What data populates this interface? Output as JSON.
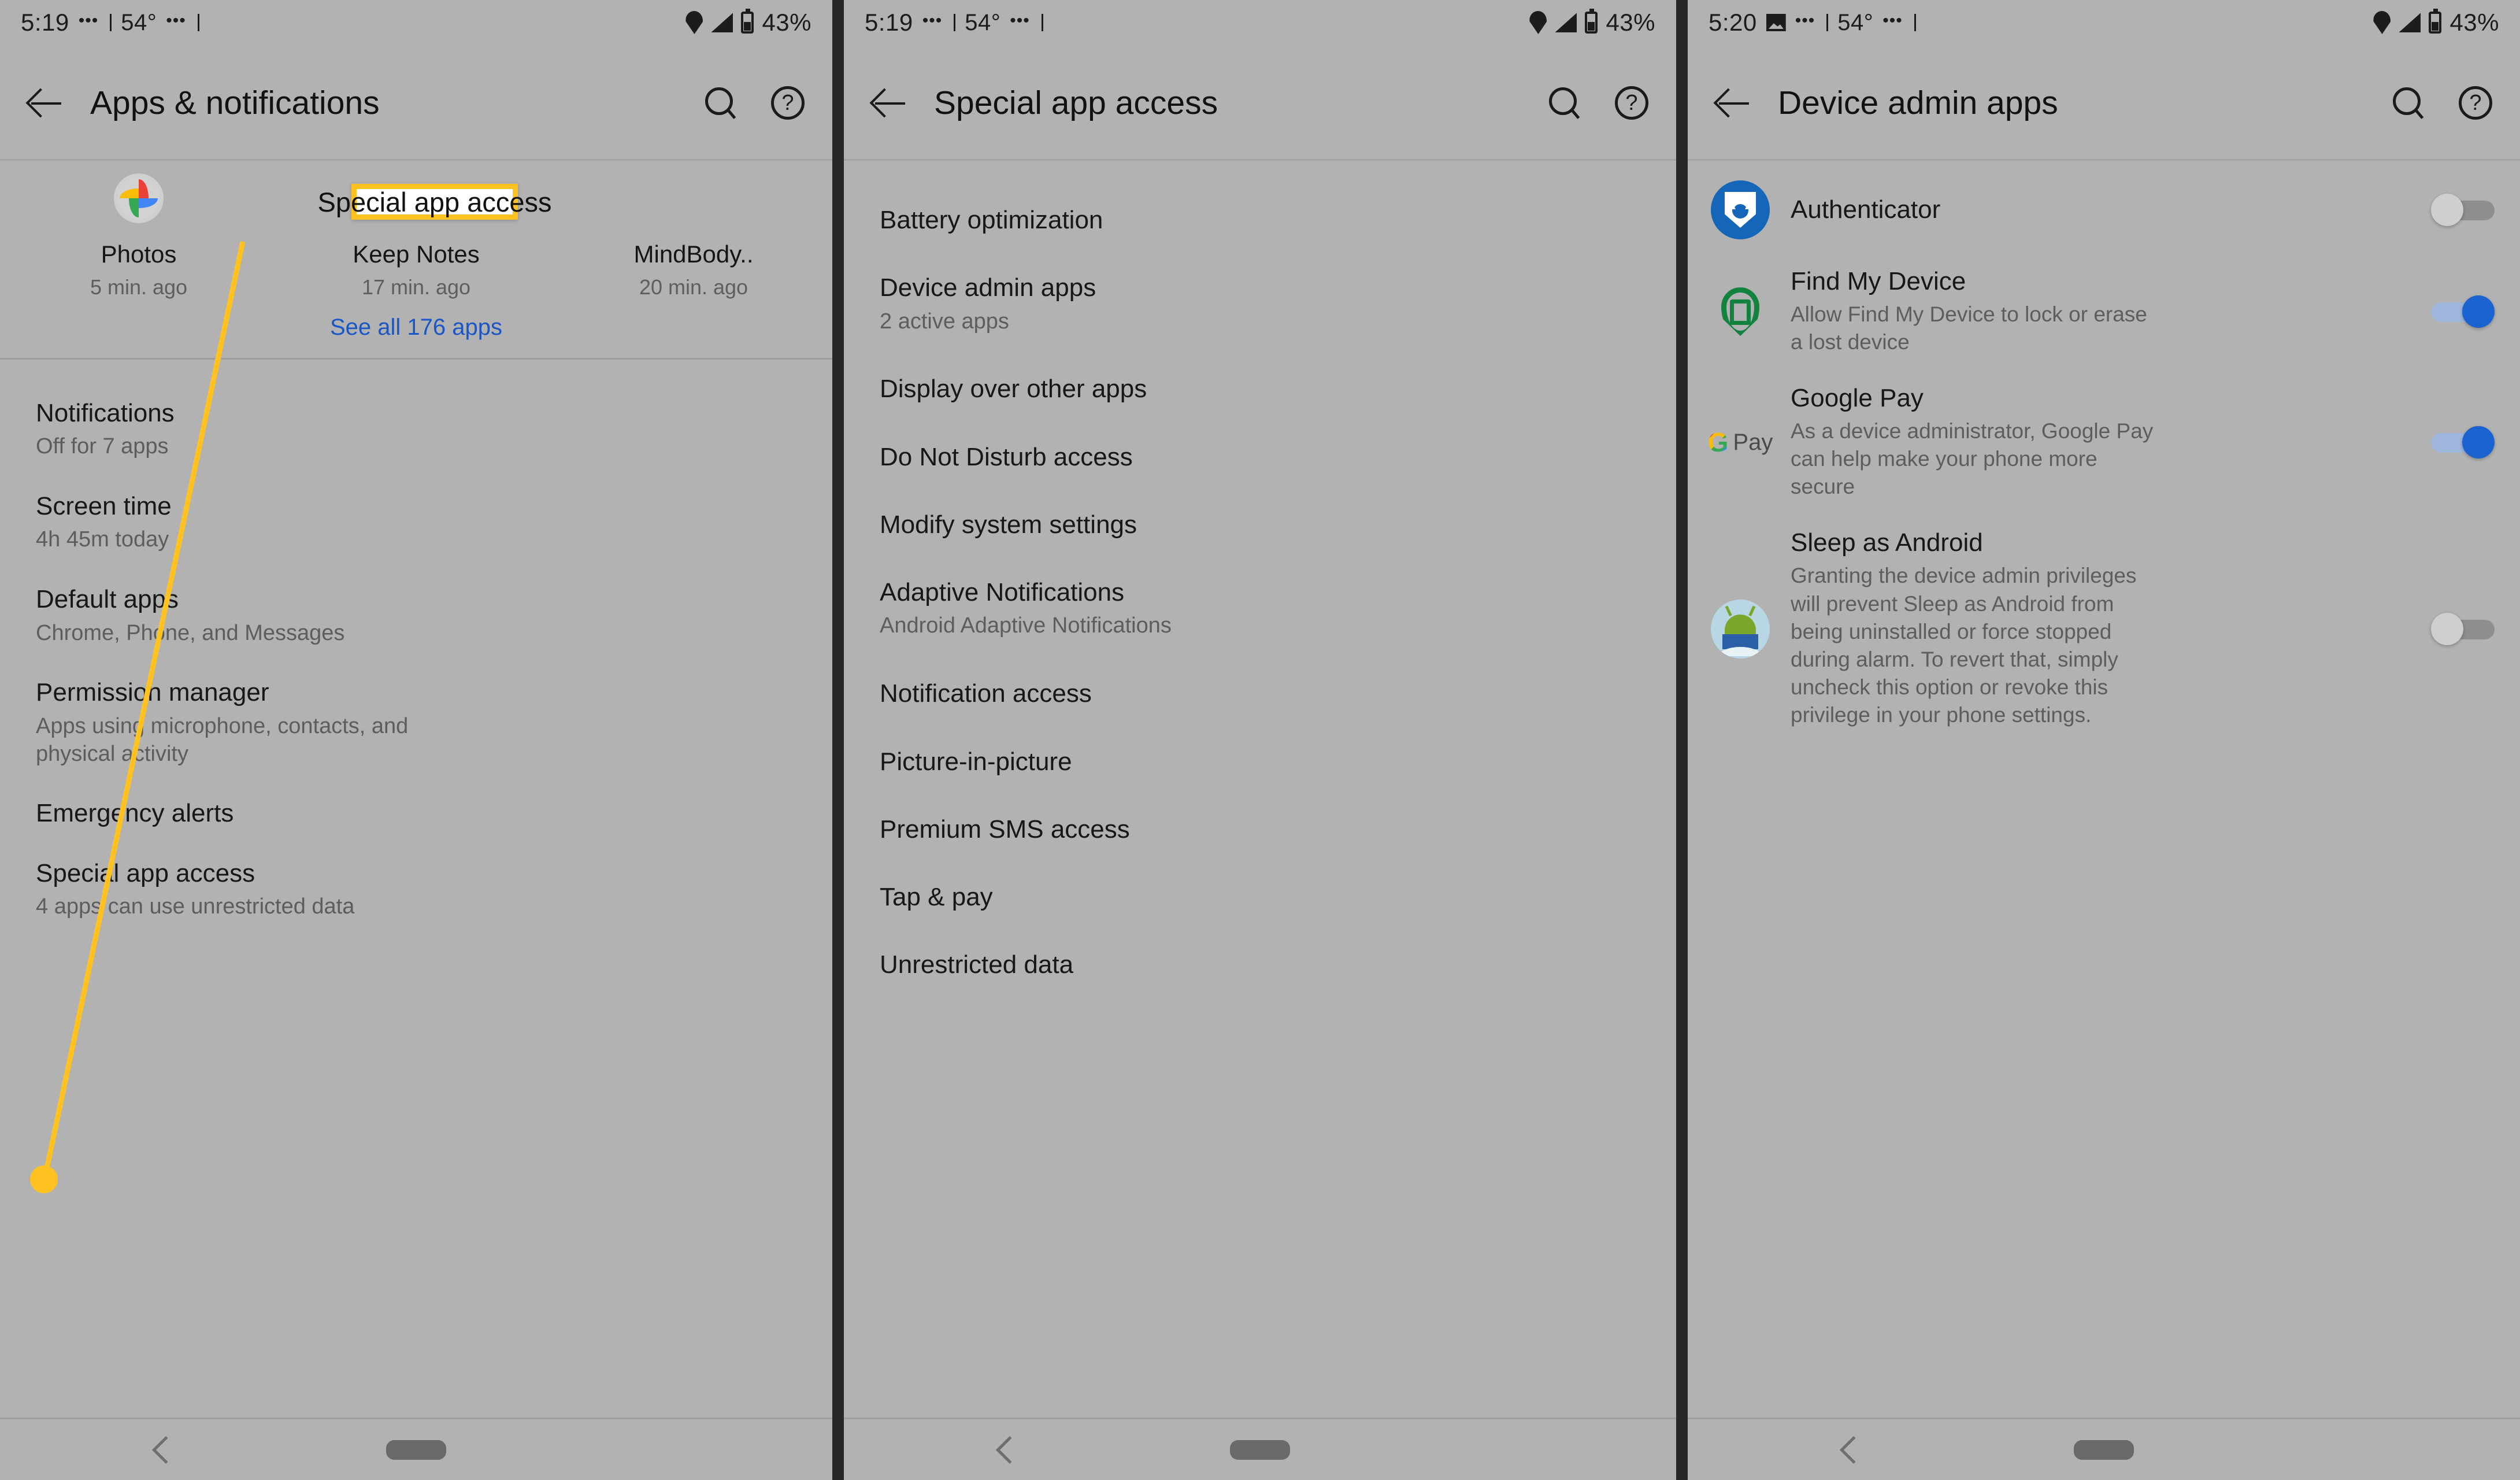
{
  "callout": {
    "label": "Special app access",
    "border_color": "#FFC220",
    "line_color": "#FFC220"
  },
  "nav": {
    "back_icon": "chevron-left-icon",
    "home_icon": "home-pill-icon"
  },
  "panel1": {
    "status": {
      "time": "5:19",
      "dots_left": "•••",
      "temp": "54°",
      "dots_right": "•••",
      "location_icon": "location-icon",
      "signal_icon": "signal-icon",
      "battery_icon": "battery-icon",
      "battery_pct": "43%"
    },
    "appbar": {
      "back_icon": "back-arrow-icon",
      "title": "Apps & notifications",
      "search_icon": "search-icon",
      "help_icon": "help-icon",
      "help_glyph": "?"
    },
    "suggested_apps": [
      {
        "name": "Photos",
        "time": "5 min. ago",
        "icon": "google-photos-icon"
      },
      {
        "name": "Keep Notes",
        "time": "17 min. ago",
        "icon": "google-keep-icon"
      },
      {
        "name": "MindBody..",
        "time": "20 min. ago",
        "icon": "mindbody-icon"
      }
    ],
    "see_all": "See all 176 apps",
    "items": [
      {
        "title": "Notifications",
        "sub": "Off for 7 apps"
      },
      {
        "title": "Screen time",
        "sub": "4h 45m today"
      },
      {
        "title": "Default apps",
        "sub": "Chrome, Phone, and Messages"
      },
      {
        "title": "Permission manager",
        "sub": "Apps using microphone, contacts, and physical activity"
      },
      {
        "title": "Emergency alerts",
        "sub": ""
      },
      {
        "title": "Special app access",
        "sub": "4 apps can use unrestricted data"
      }
    ]
  },
  "panel2": {
    "status": {
      "time": "5:19",
      "dots_left": "•••",
      "temp": "54°",
      "dots_right": "•••",
      "battery_pct": "43%"
    },
    "appbar": {
      "title": "Special app access",
      "search_icon": "search-icon",
      "help_icon": "help-icon",
      "help_glyph": "?"
    },
    "items": [
      {
        "title": "Battery optimization",
        "sub": ""
      },
      {
        "title": "Device admin apps",
        "sub": "2 active apps"
      },
      {
        "title": "Display over other apps",
        "sub": ""
      },
      {
        "title": "Do Not Disturb access",
        "sub": ""
      },
      {
        "title": "Modify system settings",
        "sub": ""
      },
      {
        "title": "Adaptive Notifications",
        "sub": "Android Adaptive Notifications"
      },
      {
        "title": "Notification access",
        "sub": ""
      },
      {
        "title": "Picture-in-picture",
        "sub": ""
      },
      {
        "title": "Premium SMS access",
        "sub": ""
      },
      {
        "title": "Tap & pay",
        "sub": ""
      },
      {
        "title": "Unrestricted data",
        "sub": ""
      }
    ]
  },
  "panel3": {
    "status": {
      "time": "5:20",
      "image_icon": "image-icon",
      "dots_left": "•••",
      "temp": "54°",
      "dots_right": "•••",
      "battery_pct": "43%"
    },
    "appbar": {
      "title": "Device admin apps",
      "search_icon": "search-icon",
      "help_icon": "help-icon",
      "help_glyph": "?"
    },
    "apps": [
      {
        "name": "Authenticator",
        "desc": "",
        "icon": "authenticator-shield-icon",
        "toggle": "off"
      },
      {
        "name": "Find My Device",
        "desc": "Allow Find My Device to lock or erase a lost device",
        "icon": "find-my-device-pin-icon",
        "toggle": "on"
      },
      {
        "name": "Google Pay",
        "desc": "As a device administrator, Google Pay can help make your phone more secure",
        "icon": "google-pay-icon",
        "icon_text": "Pay",
        "toggle": "on"
      },
      {
        "name": "Sleep as Android",
        "desc": "Granting the device admin privileges will prevent Sleep as Android from being uninstalled or force stopped during alarm. To revert that, simply uncheck this option or revoke this privilege in your phone settings.",
        "icon": "sleep-as-android-icon",
        "toggle": "off"
      }
    ]
  }
}
